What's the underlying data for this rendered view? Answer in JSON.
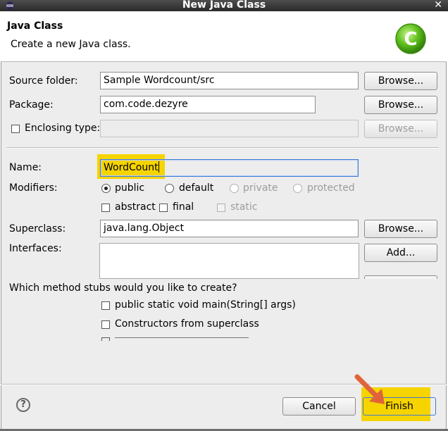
{
  "window": {
    "title": "New Java Class",
    "close_glyph": "✕"
  },
  "header": {
    "title": "Java Class",
    "description": "Create a new Java class."
  },
  "form": {
    "source_folder": {
      "label": "Source folder:",
      "value": "Sample Wordcount/src",
      "browse": "Browse..."
    },
    "package": {
      "label": "Package:",
      "value": "com.code.dezyre",
      "browse": "Browse..."
    },
    "enclosing_type": {
      "label": "Enclosing type:",
      "value": "",
      "browse": "Browse..."
    },
    "name": {
      "label": "Name:",
      "value": "WordCount"
    },
    "modifiers": {
      "label": "Modifiers:",
      "public": "public",
      "default": "default",
      "private": "private",
      "protected": "protected",
      "abstract": "abstract",
      "final": "final",
      "static": "static"
    },
    "superclass": {
      "label": "Superclass:",
      "value": "java.lang.Object",
      "browse": "Browse..."
    },
    "interfaces": {
      "label": "Interfaces:",
      "add": "Add..."
    },
    "stubs": {
      "question": "Which method stubs would you like to create?",
      "main": "public static void main(String[] args)",
      "constructors": "Constructors from superclass"
    }
  },
  "footer": {
    "help": "?",
    "cancel": "Cancel",
    "finish": "Finish"
  },
  "colors": {
    "highlight": "#f6d400",
    "arrow": "#e0643a",
    "accent_green": "#5fbf1d"
  }
}
